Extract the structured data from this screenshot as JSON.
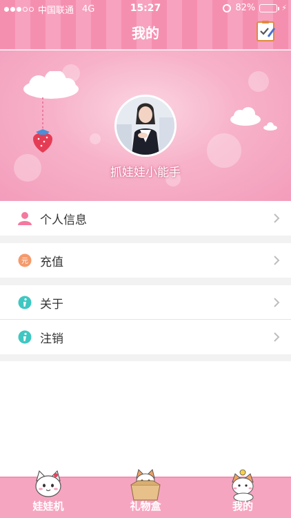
{
  "status_bar": {
    "carrier": "中国联通",
    "network": "4G",
    "time": "15:27",
    "battery": "82%",
    "battery_level": 0.82
  },
  "nav": {
    "title": "我的",
    "edit_icon": "checklist-edit-icon"
  },
  "profile": {
    "username": "抓娃娃小能手",
    "avatar_icon": "user-avatar-photo"
  },
  "menu": {
    "items": [
      {
        "label": "个人信息",
        "icon": "person-icon",
        "color": "#f4799f"
      },
      {
        "label": "充值",
        "icon": "recharge-coin-icon",
        "color": "#f59a6b"
      },
      {
        "label": "关于",
        "icon": "info-icon",
        "color": "#3fc7c2"
      },
      {
        "label": "注销",
        "icon": "info-icon",
        "color": "#3fc7c2"
      }
    ]
  },
  "tabbar": {
    "tabs": [
      {
        "label": "娃娃机",
        "icon": "white-cat-icon"
      },
      {
        "label": "礼物盒",
        "icon": "cat-in-box-icon"
      },
      {
        "label": "我的",
        "icon": "cat-with-bird-icon"
      }
    ]
  },
  "colors": {
    "brand_pink": "#f58fb0",
    "tabbar_pink": "#f6a5c0",
    "battery_green": "#4cd964"
  }
}
